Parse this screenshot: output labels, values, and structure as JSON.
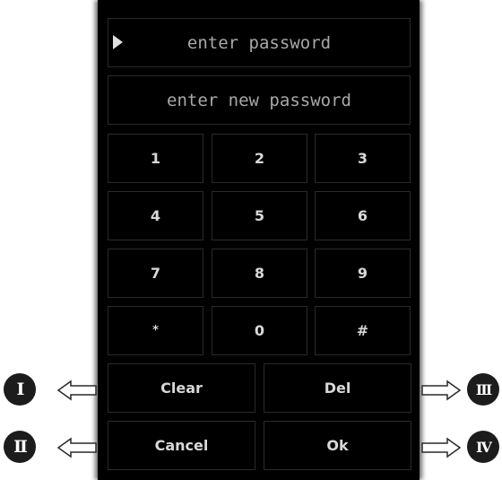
{
  "fields": {
    "password_placeholder": "enter password",
    "new_password_placeholder": "enter new password"
  },
  "keypad": [
    [
      "1",
      "2",
      "3"
    ],
    [
      "4",
      "5",
      "6"
    ],
    [
      "7",
      "8",
      "9"
    ],
    [
      "*",
      "0",
      "#"
    ]
  ],
  "actions": {
    "clear": "Clear",
    "del": "Del",
    "cancel": "Cancel",
    "ok": "Ok"
  },
  "callouts": {
    "clear": "I",
    "cancel": "II",
    "del": "III",
    "ok": "IV"
  },
  "colors": {
    "background": "#000000",
    "key_border": "#2a2a2a",
    "key_text": "#d8d8d8",
    "field_text": "#a8a8a8"
  },
  "icons": {
    "active_field": "play-triangle-icon",
    "callout_arrow": "outline-arrow-icon"
  }
}
